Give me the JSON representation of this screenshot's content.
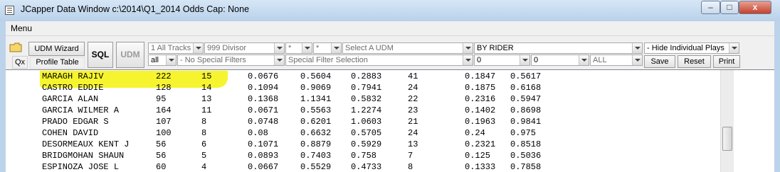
{
  "window": {
    "title": "JCapper Data Window c:\\2014\\Q1_2014 Odds Cap: None",
    "minimize": "–",
    "maximize": "□",
    "close": "x"
  },
  "menu": {
    "label": "Menu"
  },
  "toolbar": {
    "qx": "Qx",
    "udm_wizard": "UDM Wizard",
    "profile_table": "Profile Table",
    "sql": "SQL",
    "udm": "UDM",
    "tracks": "1 All Tracks",
    "divisor": "999 Divisor",
    "star1": "*",
    "star2": "*",
    "select_udm": "Select A UDM",
    "by_rider": "BY RIDER",
    "hide_plays": "- Hide Individual Plays",
    "all": "all",
    "no_special_filters": "- No Special Filters",
    "special_filter_selection": "Special Filter Selection",
    "zero1": "0",
    "zero2": "0",
    "all_caps": "ALL",
    "save": "Save",
    "reset": "Reset",
    "print": "Print"
  },
  "accent": {
    "highlight": "#f6f42e"
  },
  "rows": [
    [
      "MARAGH RAJIV",
      "222",
      "15",
      "0.0676",
      "0.5604",
      "0.2883",
      "41",
      "0.1847",
      "0.5617"
    ],
    [
      "CASTRO EDDIE",
      "128",
      "14",
      "0.1094",
      "0.9069",
      "0.7941",
      "24",
      "0.1875",
      "0.6168"
    ],
    [
      "GARCIA ALAN",
      "95",
      "13",
      "0.1368",
      "1.1341",
      "0.5832",
      "22",
      "0.2316",
      "0.5947"
    ],
    [
      "GARCIA WILMER A",
      "164",
      "11",
      "0.0671",
      "0.5563",
      "1.2274",
      "23",
      "0.1402",
      "0.8698"
    ],
    [
      "PRADO EDGAR S",
      "107",
      "8",
      "0.0748",
      "0.6201",
      "1.0603",
      "21",
      "0.1963",
      "0.9841"
    ],
    [
      "COHEN DAVID",
      "100",
      "8",
      "0.08",
      "0.6632",
      "0.5705",
      "24",
      "0.24",
      "0.975"
    ],
    [
      "DESORMEAUX KENT J",
      "56",
      "6",
      "0.1071",
      "0.8879",
      "0.5929",
      "13",
      "0.2321",
      "0.8518"
    ],
    [
      "BRIDGMOHAN SHAUN",
      "56",
      "5",
      "0.0893",
      "0.7403",
      "0.758",
      "7",
      "0.125",
      "0.5036"
    ],
    [
      "ESPINOZA JOSE L",
      "60",
      "4",
      "0.0667",
      "0.5529",
      "0.4733",
      "8",
      "0.1333",
      "0.7858"
    ]
  ]
}
